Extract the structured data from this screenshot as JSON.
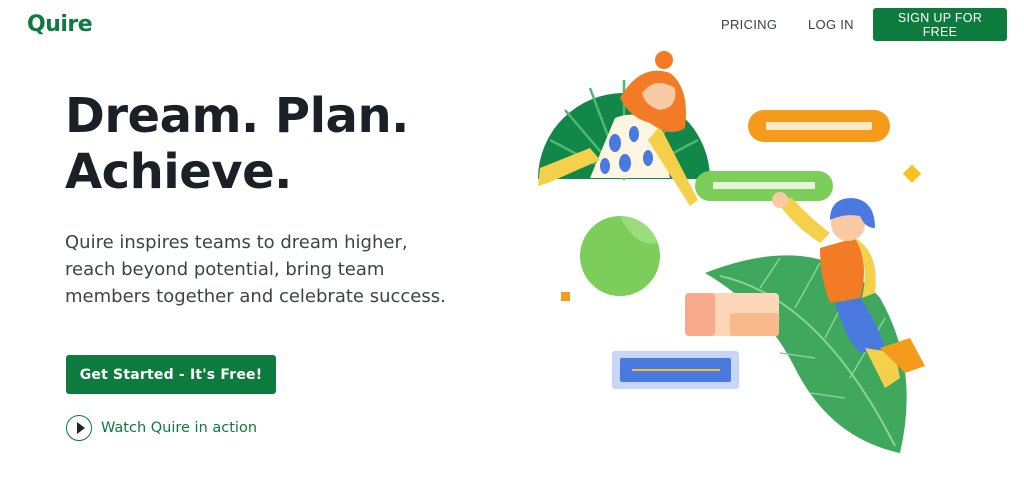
{
  "brand": {
    "name": "Quire",
    "accent": "#0d7a3e"
  },
  "nav": {
    "pricing": "PRICING",
    "login": "LOG IN",
    "signup": "SIGN UP FOR FREE"
  },
  "hero": {
    "headline_lines": [
      "Dream. Plan.",
      "Achieve."
    ],
    "subtext_lines": [
      "Quire inspires teams to dream higher,",
      "reach beyond potential, bring team",
      "members together and celebrate success."
    ],
    "cta": "Get Started - It's Free!",
    "watch_label": "Watch Quire in action",
    "watch_icon": "play-icon"
  },
  "illustration": {
    "colors": {
      "dark_green": "#12874a",
      "leaf_green": "#3fa85c",
      "light_green": "#7ccd5a",
      "orange": "#f59b1c",
      "blue": "#4a79e0",
      "yellow": "#f5d04a",
      "peach": "#f8a98c"
    }
  }
}
